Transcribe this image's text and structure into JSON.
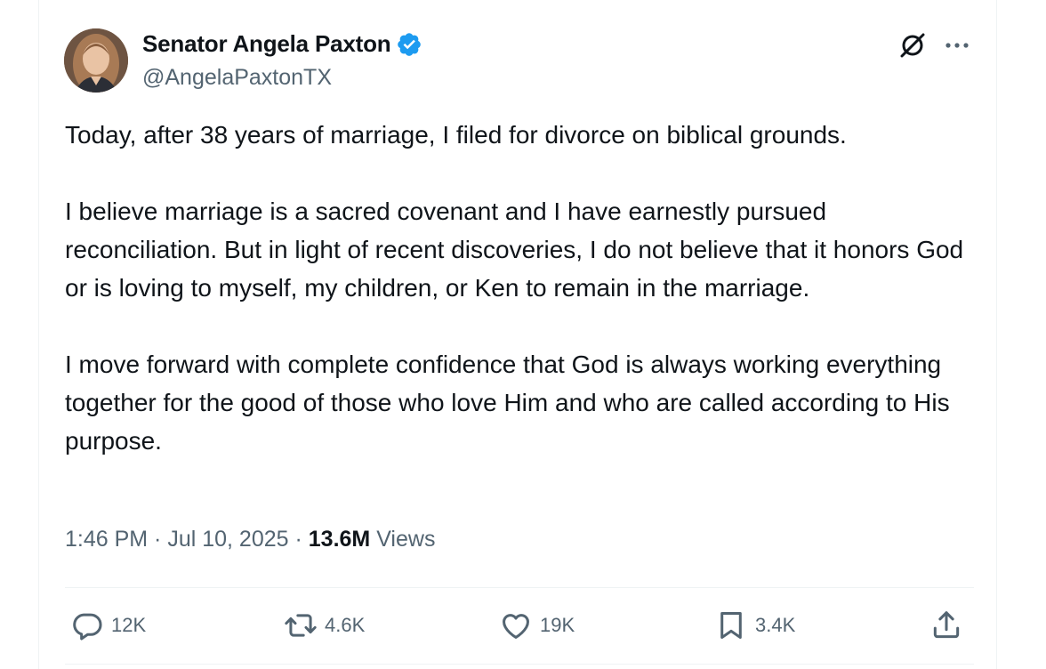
{
  "author": {
    "display_name": "Senator Angela Paxton",
    "handle": "@AngelaPaxtonTX",
    "verified": true,
    "verified_color": "#1d9bf0"
  },
  "tweet": {
    "paragraphs": [
      "Today, after 38 years of marriage, I filed for divorce on biblical grounds.",
      "I believe marriage is a sacred covenant and I have earnestly pursued reconciliation. But in light of recent discoveries, I do not believe that it honors God or is loving to myself, my children, or Ken to remain in the marriage.",
      "I move forward with complete confidence that God is always working everything together for the good of those who love Him and who are called according to His purpose."
    ]
  },
  "meta": {
    "time": "1:46 PM",
    "separator": " · ",
    "date": "Jul 10, 2025",
    "views_count": "13.6M",
    "views_label": "Views"
  },
  "actions": {
    "replies": "12K",
    "reposts": "4.6K",
    "likes": "19K",
    "bookmarks": "3.4K"
  },
  "icons": {
    "top_right": [
      "grok-icon",
      "more-icon"
    ],
    "actions": [
      "reply-icon",
      "repost-icon",
      "like-icon",
      "bookmark-icon",
      "share-icon"
    ]
  },
  "colors": {
    "text_primary": "#0f1419",
    "text_secondary": "#536471",
    "divider": "#eff3f4"
  }
}
